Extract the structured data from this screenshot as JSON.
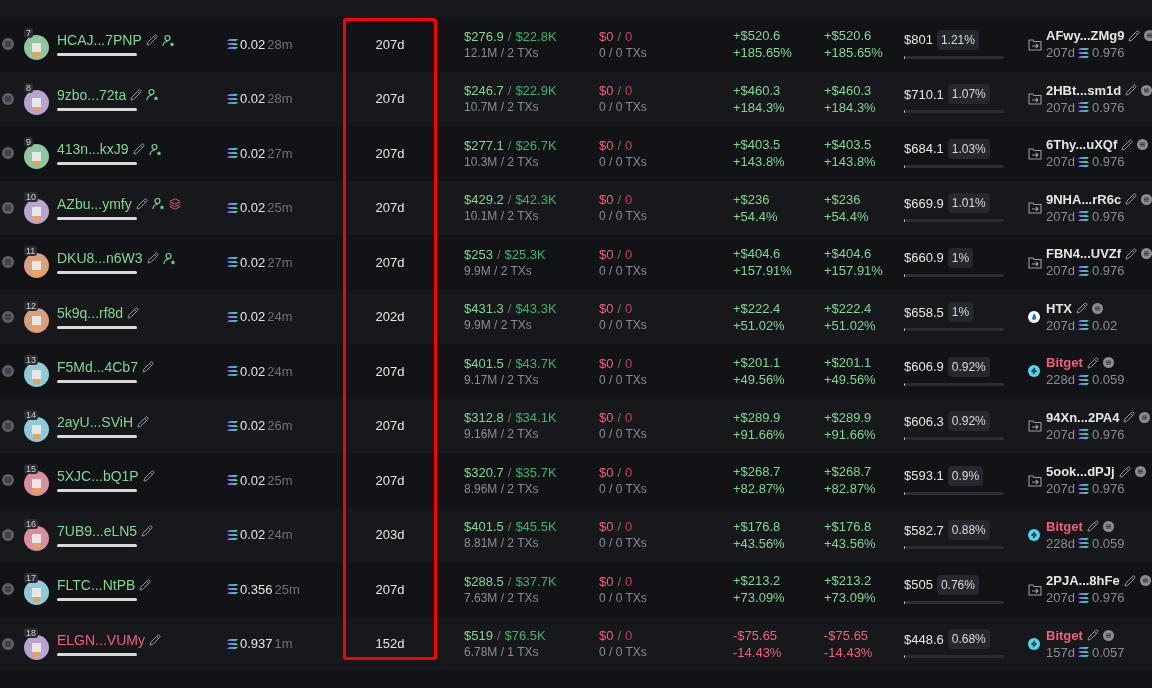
{
  "rows": [
    {
      "rank": "7",
      "name": "HCAJ...7PNP",
      "loss": false,
      "tags": [
        {
          "kind": "edit"
        },
        {
          "kind": "follower"
        }
      ],
      "sol": "0.02",
      "time": "28m",
      "age": "207d",
      "bought": {
        "amount": "$276.9",
        "sep": "/",
        "total": "$22.8K",
        "sub": "12.1M / 2 TXs"
      },
      "sold": {
        "amount": "$0",
        "sep": "/",
        "total": "0",
        "sub": "0 / 0 TXs"
      },
      "pnl": "+$520.6",
      "pnl_pct": "+185.65%",
      "pnl2": "+$520.6",
      "pnl2_pct": "+185.65%",
      "balance": "$801",
      "share": "1.21%",
      "level": 0.01,
      "source": {
        "kind": "wallet",
        "name": "AFwy...ZMg9",
        "age": "207d",
        "sol": "0.976"
      }
    },
    {
      "rank": "8",
      "name": "9zbo...72ta",
      "loss": false,
      "tags": [
        {
          "kind": "edit"
        },
        {
          "kind": "follower"
        }
      ],
      "sol": "0.02",
      "time": "28m",
      "age": "207d",
      "bought": {
        "amount": "$246.7",
        "sep": "/",
        "total": "$22.9K",
        "sub": "10.7M / 2 TXs"
      },
      "sold": {
        "amount": "$0",
        "sep": "/",
        "total": "0",
        "sub": "0 / 0 TXs"
      },
      "pnl": "+$460.3",
      "pnl_pct": "+184.3%",
      "pnl2": "+$460.3",
      "pnl2_pct": "+184.3%",
      "balance": "$710.1",
      "share": "1.07%",
      "level": 0.01,
      "source": {
        "kind": "wallet",
        "name": "2HBt...sm1d",
        "age": "207d",
        "sol": "0.976"
      }
    },
    {
      "rank": "9",
      "name": "413n...kxJ9",
      "loss": false,
      "tags": [
        {
          "kind": "edit"
        },
        {
          "kind": "follower"
        }
      ],
      "sol": "0.02",
      "time": "27m",
      "age": "207d",
      "bought": {
        "amount": "$277.1",
        "sep": "/",
        "total": "$26.7K",
        "sub": "10.3M / 2 TXs"
      },
      "sold": {
        "amount": "$0",
        "sep": "/",
        "total": "0",
        "sub": "0 / 0 TXs"
      },
      "pnl": "+$403.5",
      "pnl_pct": "+143.8%",
      "pnl2": "+$403.5",
      "pnl2_pct": "+143.8%",
      "balance": "$684.1",
      "share": "1.03%",
      "level": 0.01,
      "source": {
        "kind": "wallet",
        "name": "6Thy...uXQf",
        "age": "207d",
        "sol": "0.976"
      }
    },
    {
      "rank": "10",
      "name": "AZbu...ymfy",
      "loss": false,
      "tags": [
        {
          "kind": "edit"
        },
        {
          "kind": "follower"
        },
        {
          "kind": "layers"
        }
      ],
      "sol": "0.02",
      "time": "25m",
      "age": "207d",
      "bought": {
        "amount": "$429.2",
        "sep": "/",
        "total": "$42.3K",
        "sub": "10.1M / 2 TXs"
      },
      "sold": {
        "amount": "$0",
        "sep": "/",
        "total": "0",
        "sub": "0 / 0 TXs"
      },
      "pnl": "+$236",
      "pnl_pct": "+54.4%",
      "pnl2": "+$236",
      "pnl2_pct": "+54.4%",
      "balance": "$669.9",
      "share": "1.01%",
      "level": 0.01,
      "source": {
        "kind": "wallet",
        "name": "9NHA...rR6c",
        "age": "207d",
        "sol": "0.976"
      }
    },
    {
      "rank": "11",
      "name": "DKU8...n6W3",
      "loss": false,
      "tags": [
        {
          "kind": "edit"
        },
        {
          "kind": "follower"
        }
      ],
      "sol": "0.02",
      "time": "27m",
      "age": "207d",
      "bought": {
        "amount": "$253",
        "sep": "/",
        "total": "$25.3K",
        "sub": "9.9M / 2 TXs"
      },
      "sold": {
        "amount": "$0",
        "sep": "/",
        "total": "0",
        "sub": "0 / 0 TXs"
      },
      "pnl": "+$404.6",
      "pnl_pct": "+157.91%",
      "pnl2": "+$404.6",
      "pnl2_pct": "+157.91%",
      "balance": "$660.9",
      "share": "1%",
      "level": 0.01,
      "source": {
        "kind": "wallet",
        "name": "FBN4...UVZf",
        "age": "207d",
        "sol": "0.976"
      }
    },
    {
      "rank": "12",
      "name": "5k9q...rf8d",
      "loss": false,
      "tags": [
        {
          "kind": "edit"
        }
      ],
      "sol": "0.02",
      "time": "24m",
      "age": "202d",
      "bought": {
        "amount": "$431.3",
        "sep": "/",
        "total": "$43.3K",
        "sub": "9.9M / 2 TXs"
      },
      "sold": {
        "amount": "$0",
        "sep": "/",
        "total": "0",
        "sub": "0 / 0 TXs"
      },
      "pnl": "+$222.4",
      "pnl_pct": "+51.02%",
      "pnl2": "+$222.4",
      "pnl2_pct": "+51.02%",
      "balance": "$658.5",
      "share": "1%",
      "level": 0.01,
      "source": {
        "kind": "htx",
        "name": "HTX",
        "age": "207d",
        "sol": "0.02"
      }
    },
    {
      "rank": "13",
      "name": "F5Md...4Cb7",
      "loss": false,
      "tags": [
        {
          "kind": "edit"
        }
      ],
      "sol": "0.02",
      "time": "24m",
      "age": "207d",
      "bought": {
        "amount": "$401.5",
        "sep": "/",
        "total": "$43.7K",
        "sub": "9.17M / 2 TXs"
      },
      "sold": {
        "amount": "$0",
        "sep": "/",
        "total": "0",
        "sub": "0 / 0 TXs"
      },
      "pnl": "+$201.1",
      "pnl_pct": "+49.56%",
      "pnl2": "+$201.1",
      "pnl2_pct": "+49.56%",
      "balance": "$606.9",
      "share": "0.92%",
      "level": 0.01,
      "source": {
        "kind": "bitget",
        "name": "Bitget",
        "age": "228d",
        "sol": "0.059"
      }
    },
    {
      "rank": "14",
      "name": "2ayU...SViH",
      "loss": false,
      "tags": [
        {
          "kind": "edit"
        }
      ],
      "sol": "0.02",
      "time": "26m",
      "age": "207d",
      "bought": {
        "amount": "$312.8",
        "sep": "/",
        "total": "$34.1K",
        "sub": "9.16M / 2 TXs"
      },
      "sold": {
        "amount": "$0",
        "sep": "/",
        "total": "0",
        "sub": "0 / 0 TXs"
      },
      "pnl": "+$289.9",
      "pnl_pct": "+91.66%",
      "pnl2": "+$289.9",
      "pnl2_pct": "+91.66%",
      "balance": "$606.3",
      "share": "0.92%",
      "level": 0.01,
      "source": {
        "kind": "wallet",
        "name": "94Xn...2PA4",
        "age": "207d",
        "sol": "0.976"
      }
    },
    {
      "rank": "15",
      "name": "5XJC...bQ1P",
      "loss": false,
      "tags": [
        {
          "kind": "edit"
        }
      ],
      "sol": "0.02",
      "time": "25m",
      "age": "207d",
      "bought": {
        "amount": "$320.7",
        "sep": "/",
        "total": "$35.7K",
        "sub": "8.96M / 2 TXs"
      },
      "sold": {
        "amount": "$0",
        "sep": "/",
        "total": "0",
        "sub": "0 / 0 TXs"
      },
      "pnl": "+$268.7",
      "pnl_pct": "+82.87%",
      "pnl2": "+$268.7",
      "pnl2_pct": "+82.87%",
      "balance": "$593.1",
      "share": "0.9%",
      "level": 0.01,
      "source": {
        "kind": "wallet",
        "name": "5ook...dPJj",
        "age": "207d",
        "sol": "0.976"
      }
    },
    {
      "rank": "16",
      "name": "7UB9...eLN5",
      "loss": false,
      "tags": [
        {
          "kind": "edit"
        }
      ],
      "sol": "0.02",
      "time": "24m",
      "age": "203d",
      "bought": {
        "amount": "$401.5",
        "sep": "/",
        "total": "$45.5K",
        "sub": "8.81M / 2 TXs"
      },
      "sold": {
        "amount": "$0",
        "sep": "/",
        "total": "0",
        "sub": "0 / 0 TXs"
      },
      "pnl": "+$176.8",
      "pnl_pct": "+43.56%",
      "pnl2": "+$176.8",
      "pnl2_pct": "+43.56%",
      "balance": "$582.7",
      "share": "0.88%",
      "level": 0.01,
      "source": {
        "kind": "bitget",
        "name": "Bitget",
        "age": "228d",
        "sol": "0.059"
      }
    },
    {
      "rank": "17",
      "name": "FLTC...NtPB",
      "loss": false,
      "tags": [
        {
          "kind": "edit"
        }
      ],
      "sol": "0.356",
      "time": "25m",
      "age": "207d",
      "bought": {
        "amount": "$288.5",
        "sep": "/",
        "total": "$37.7K",
        "sub": "7.63M / 2 TXs"
      },
      "sold": {
        "amount": "$0",
        "sep": "/",
        "total": "0",
        "sub": "0 / 0 TXs"
      },
      "pnl": "+$213.2",
      "pnl_pct": "+73.09%",
      "pnl2": "+$213.2",
      "pnl2_pct": "+73.09%",
      "balance": "$505",
      "share": "0.76%",
      "level": 0.01,
      "source": {
        "kind": "wallet",
        "name": "2PJA...8hFe",
        "age": "207d",
        "sol": "0.976"
      }
    },
    {
      "rank": "18",
      "name": "ELGN...VUMy",
      "loss": true,
      "tags": [
        {
          "kind": "edit"
        }
      ],
      "sol": "0.937",
      "time": "1m",
      "age": "152d",
      "bought": {
        "amount": "$519",
        "sep": "/",
        "total": "$76.5K",
        "sub": "6.78M / 1 TXs"
      },
      "sold": {
        "amount": "$0",
        "sep": "/",
        "total": "0",
        "sub": "0 / 0 TXs"
      },
      "pnl": "-$75.65",
      "pnl_pct": "-14.43%",
      "pnl2": "-$75.65",
      "pnl2_pct": "-14.43%",
      "balance": "$448.6",
      "share": "0.68%",
      "level": 0.01,
      "source": {
        "kind": "bitget",
        "name": "Bitget",
        "age": "157d",
        "sol": "0.057"
      }
    }
  ]
}
